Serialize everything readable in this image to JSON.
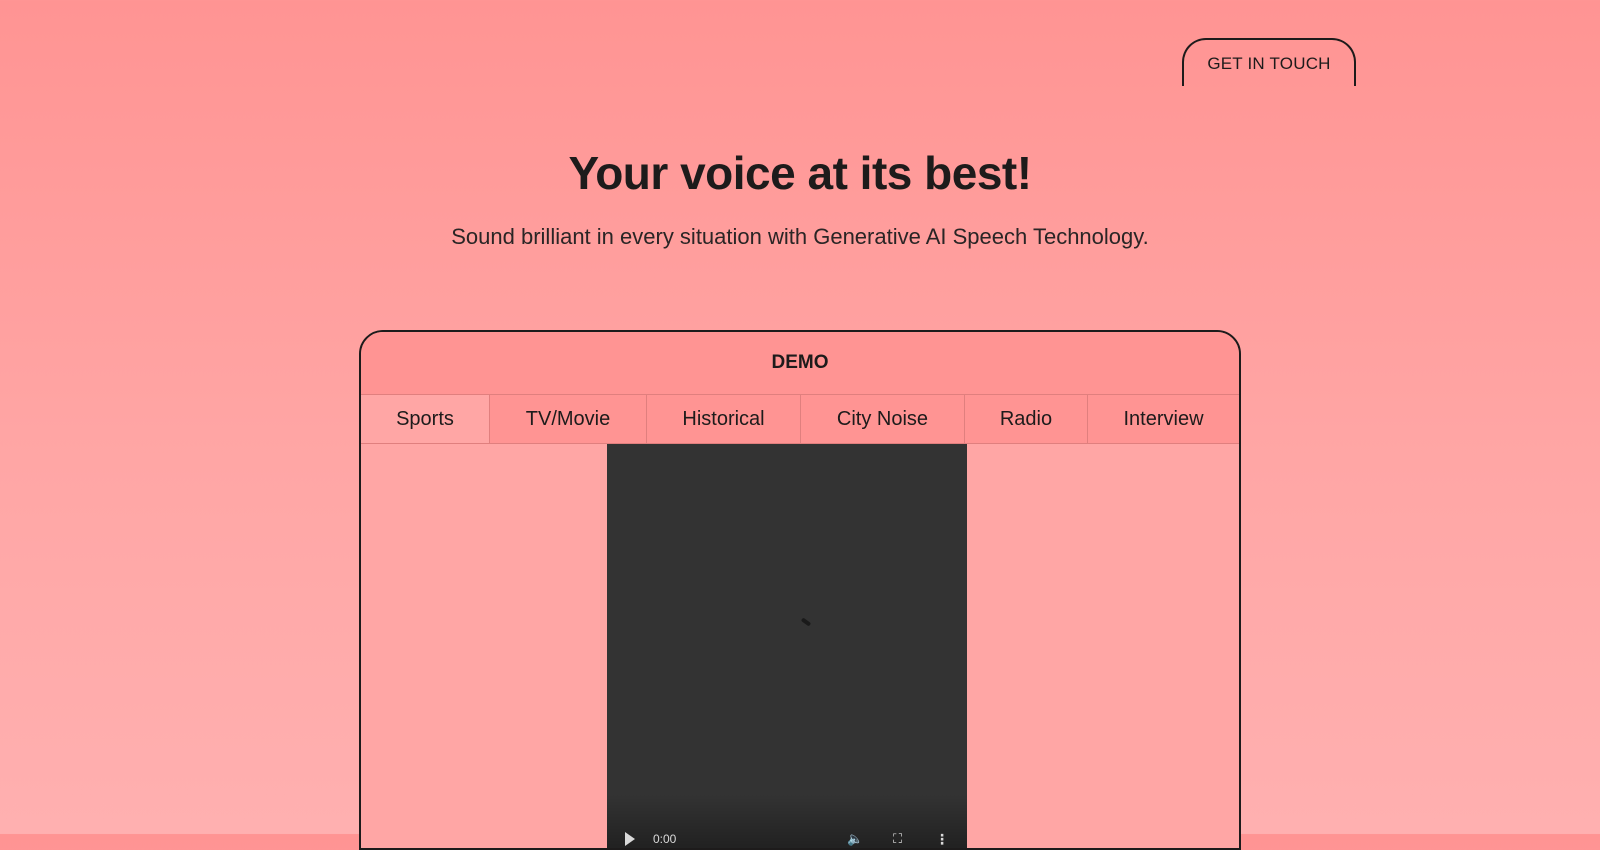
{
  "header": {
    "cta_label": "GET IN TOUCH"
  },
  "hero": {
    "title": "Your voice at its best!",
    "subtitle": "Sound brilliant in every situation with Generative AI Speech Technology."
  },
  "demo": {
    "title": "DEMO",
    "tabs": [
      {
        "label": "Sports",
        "active": true
      },
      {
        "label": "TV/Movie",
        "active": false
      },
      {
        "label": "Historical",
        "active": false
      },
      {
        "label": "City Noise",
        "active": false
      },
      {
        "label": "Radio",
        "active": false
      },
      {
        "label": "Interview",
        "active": false
      }
    ],
    "video": {
      "time": "0:00",
      "icons": {
        "play": "play-icon",
        "volume": "volume-icon",
        "fullscreen": "fullscreen-icon",
        "more": "more-vertical-icon"
      }
    }
  },
  "colors": {
    "background_top": "#ff9493",
    "background_bottom": "#ffb0b0",
    "accent": "#ff9493",
    "text": "#1d1b1b",
    "video_bg": "#333333"
  }
}
